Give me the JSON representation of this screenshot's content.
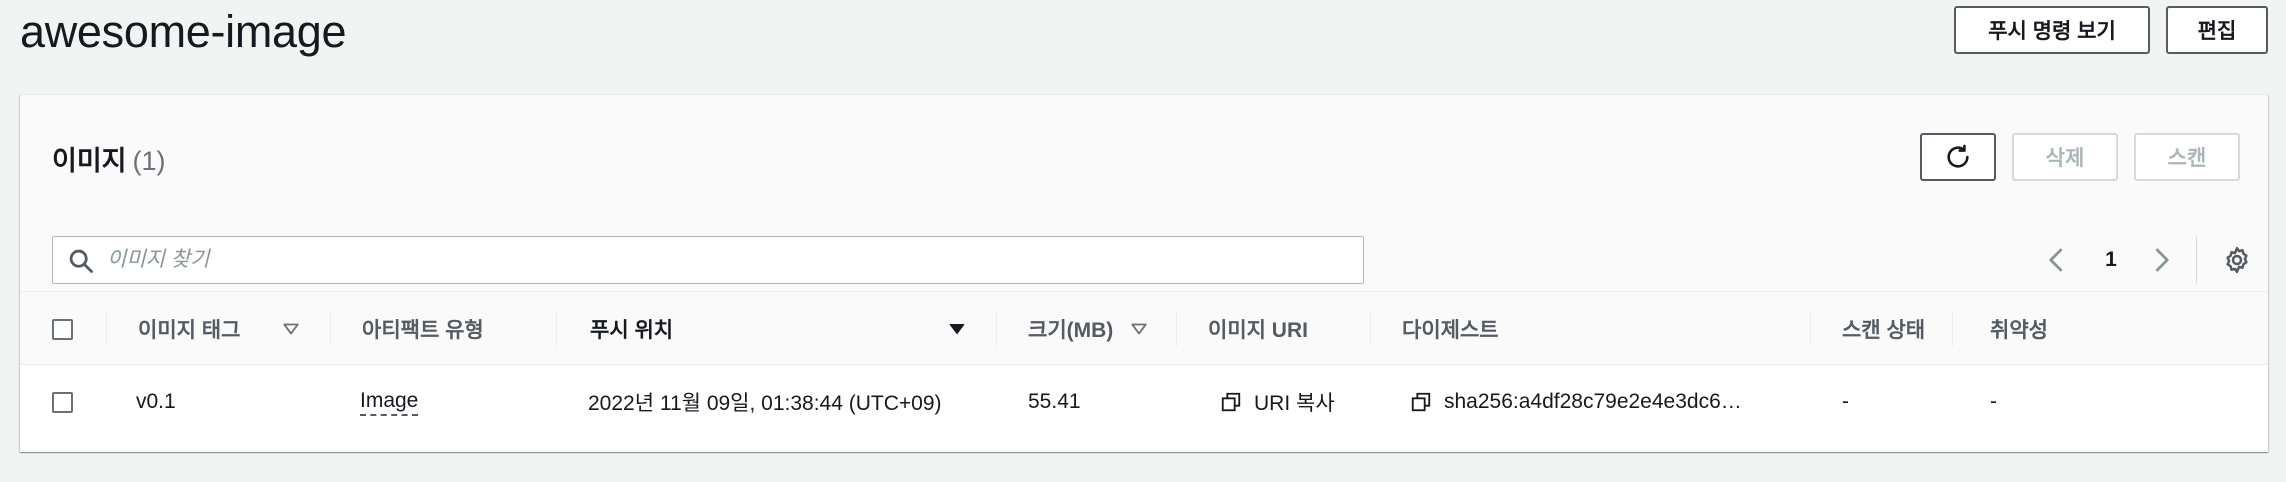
{
  "header": {
    "title": "awesome-image",
    "push_commands_label": "푸시 명령 보기",
    "edit_label": "편집"
  },
  "panel": {
    "title": "이미지",
    "count": "(1)",
    "delete_label": "삭제",
    "scan_label": "스캔",
    "search_placeholder": "이미지 찾기",
    "current_page": "1"
  },
  "table": {
    "columns": {
      "tag": "이미지 태그",
      "artifact_type": "아티팩트 유형",
      "pushed_at": "푸시 위치",
      "size": "크기(MB)",
      "uri": "이미지 URI",
      "digest": "다이제스트",
      "scan_status": "스캔 상태",
      "vulnerabilities": "취약성"
    },
    "rows": [
      {
        "tag": "v0.1",
        "artifact_type": "Image",
        "pushed_at": "2022년 11월 09일, 01:38:44 (UTC+09)",
        "size": "55.41",
        "uri": "URI 복사",
        "digest": "sha256:a4df28c79e2e4e3dc6…",
        "scan_status": "-",
        "vulnerabilities": "-"
      }
    ]
  },
  "icons": {
    "search": "search-icon",
    "refresh": "refresh-icon",
    "prev": "chevron-left-icon",
    "next": "chevron-right-icon",
    "settings": "gear-icon",
    "sort_neutral": "sort-caret-outline-icon",
    "sort_active": "sort-caret-filled-icon",
    "copy": "copy-icon"
  },
  "colors": {
    "link": "#0073bb",
    "border_strong": "#545b64",
    "border_disabled": "#d5dbdb",
    "text_disabled": "#aab7b8"
  }
}
